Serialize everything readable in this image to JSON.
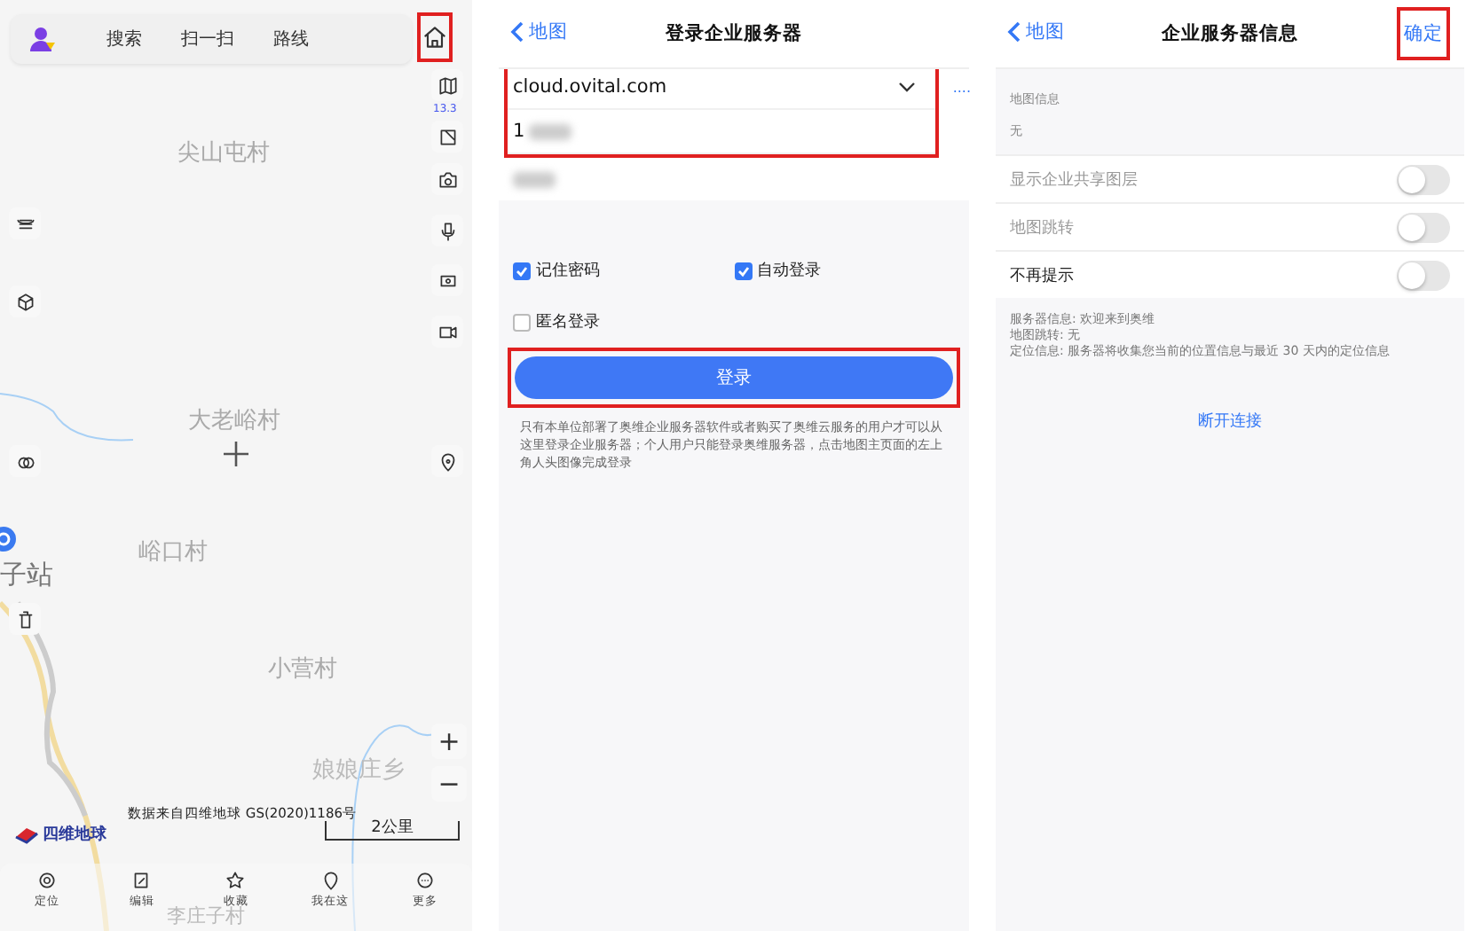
{
  "map": {
    "top_bar": {
      "items": [
        "搜索",
        "扫一扫",
        "路线"
      ],
      "home_highlighted": true
    },
    "zoom_level": "13.3",
    "place_labels": [
      "尖山屯村",
      "大老峪村",
      "峪口村",
      "子站",
      "小营村",
      "娘娘庄乡",
      "李庄子村"
    ],
    "attribution": "数据来自四维地球 GS(2020)1186号",
    "logo": "四维地球",
    "scale": "2公里",
    "zoom_buttons": [
      "+",
      "−"
    ],
    "bottom_tabs": [
      "定位",
      "编辑",
      "收藏",
      "我在这",
      "更多"
    ]
  },
  "login": {
    "back": "地图",
    "title": "登录企业服务器",
    "server": "cloud.ovital.com",
    "more": "....",
    "username": "1",
    "fields_highlighted": true,
    "options": [
      {
        "label": "记住密码",
        "checked": true
      },
      {
        "label": "自动登录",
        "checked": true
      },
      {
        "label": "匿名登录",
        "checked": false
      }
    ],
    "button": "登录",
    "button_highlighted": true,
    "note": "只有本单位部署了奥维企业服务器软件或者购买了奥维云服务的用户才可以从这里登录企业服务器；个人用户只能登录奥维服务器，点击地图主页面的左上角人头图像完成登录"
  },
  "info": {
    "back": "地图",
    "title": "企业服务器信息",
    "confirm": "确定",
    "confirm_highlighted": true,
    "section_label": "地图信息",
    "section_value": "无",
    "toggles": [
      {
        "label": "显示企业共享图层",
        "on": false,
        "disabled": true
      },
      {
        "label": "地图跳转",
        "on": false,
        "disabled": true
      },
      {
        "label": "不再提示",
        "on": false,
        "disabled": false
      }
    ],
    "details": [
      "服务器信息: 欢迎来到奥维",
      "地图跳转: 无",
      "定位信息: 服务器将收集您当前的位置信息与最近 30 天内的定位信息"
    ],
    "disconnect": "断开连接"
  }
}
